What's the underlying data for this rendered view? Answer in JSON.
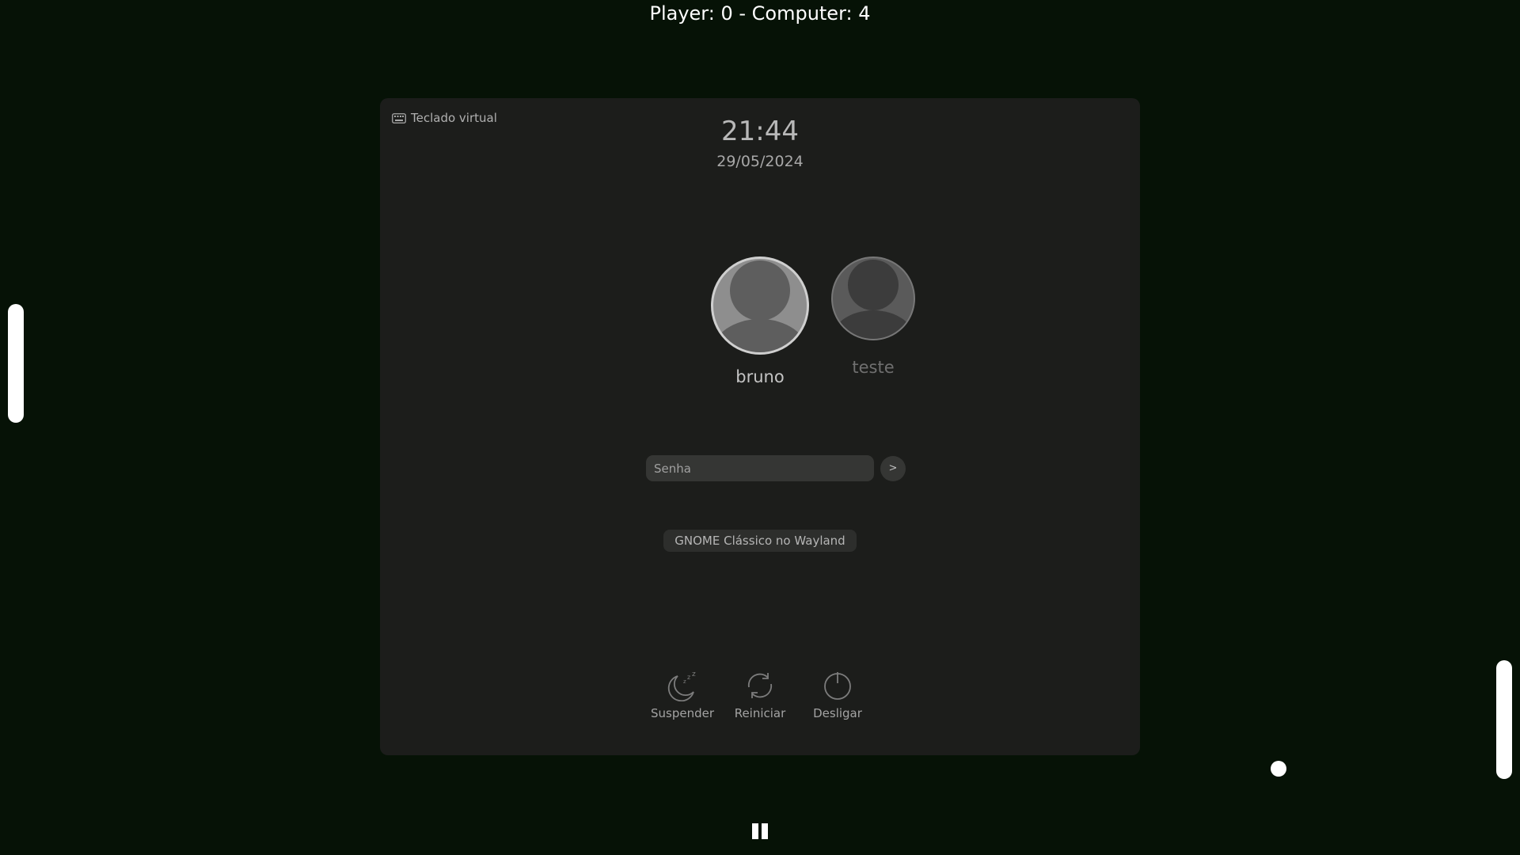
{
  "game": {
    "score": "Player: 0 - Computer: 4"
  },
  "login": {
    "virtual_keyboard_label": "Teclado virtual",
    "time": "21:44",
    "date": "29/05/2024",
    "users": [
      {
        "name": "bruno",
        "selected": true
      },
      {
        "name": "teste",
        "selected": false
      }
    ],
    "password_placeholder": "Senha",
    "submit_label": ">",
    "session_label": "GNOME Clássico no Wayland",
    "power_actions": [
      {
        "label": "Suspender",
        "icon": "moon-sleep-icon"
      },
      {
        "label": "Reiniciar",
        "icon": "restart-icon"
      },
      {
        "label": "Desligar",
        "icon": "power-icon"
      }
    ]
  },
  "colors": {
    "background": "#061206",
    "panel": "#1c1d1b",
    "game_elements": "#ffffff"
  }
}
